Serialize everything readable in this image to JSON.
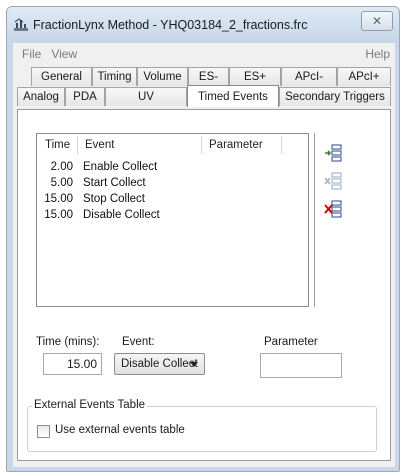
{
  "window": {
    "title": "FractionLynx Method - YHQ03184_2_fractions.frc",
    "close_glyph": "✕"
  },
  "menu": {
    "file": "File",
    "view": "View",
    "help": "Help"
  },
  "tabs": {
    "row1": [
      "General",
      "Timing",
      "Volume",
      "ES-",
      "ES+",
      "APcI-",
      "APcI+"
    ],
    "row2": [
      "Analog",
      "PDA",
      "UV",
      "Timed Events",
      "Secondary Triggers"
    ],
    "active": "Timed Events"
  },
  "events_list": {
    "columns": [
      "Time",
      "Event",
      "Parameter"
    ],
    "rows": [
      {
        "time": "2.00",
        "event": "Enable Collect",
        "parameter": ""
      },
      {
        "time": "5.00",
        "event": "Start Collect",
        "parameter": ""
      },
      {
        "time": "15.00",
        "event": "Stop Collect",
        "parameter": ""
      },
      {
        "time": "15.00",
        "event": "Disable Collect",
        "parameter": ""
      }
    ]
  },
  "side_buttons": [
    "add-event-icon",
    "modify-event-icon",
    "delete-event-icon"
  ],
  "editor": {
    "time_label": "Time (mins):",
    "time_value": "15.00",
    "event_label": "Event:",
    "event_selected": "Disable Collect",
    "parameter_label": "Parameter",
    "parameter_value": ""
  },
  "external": {
    "group_title": "External Events Table",
    "checkbox_label": "Use external events table",
    "checked": false
  },
  "colors": {
    "titlebar": "#c9d8e8",
    "face": "#f0f0f0",
    "accent_red": "#d40000",
    "accent_green": "#2e8b2e"
  }
}
